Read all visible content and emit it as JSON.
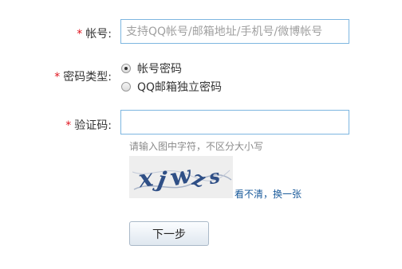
{
  "form": {
    "account": {
      "star": "*",
      "label": "帐号:",
      "placeholder": "支持QQ帐号/邮箱地址/手机号/微博帐号"
    },
    "password_type": {
      "star": "*",
      "label": "密码类型:",
      "options": [
        {
          "label": "帐号密码",
          "checked": true
        },
        {
          "label": "QQ邮箱独立密码",
          "checked": false
        }
      ]
    },
    "captcha": {
      "star": "*",
      "label": "验证码:",
      "value": "",
      "hint": "请输入图中字符，不区分大小写",
      "image_text": "xjwzs",
      "refresh_link": "看不清，换一张"
    },
    "next_button": "下一步"
  }
}
